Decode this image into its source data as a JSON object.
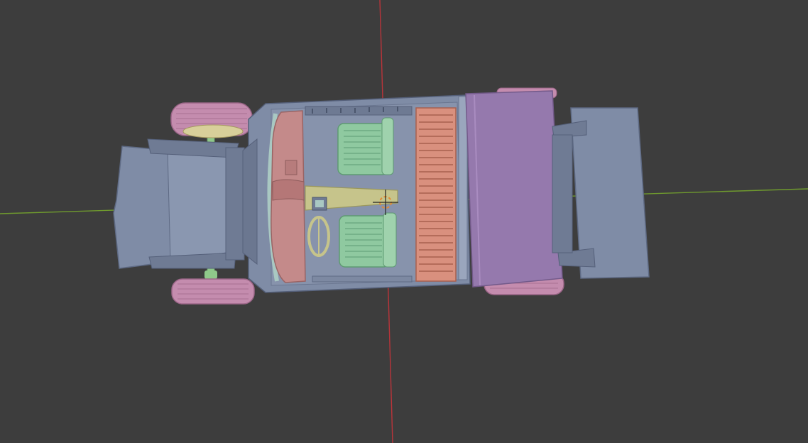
{
  "viewport": {
    "background": "#3d3d3d",
    "x_axis_color": "#6f9a2e",
    "y_axis_color": "#b9343a"
  },
  "scene": {
    "object": "car-model-top-view",
    "body_color": "#7f8ca6",
    "body_dark_color": "#5e6a84",
    "interior_floor_color": "#8793ac",
    "seat_color": "#8fc9a0",
    "dashboard_color": "#c48a8a",
    "cargo_slats_color": "#d9907e",
    "hood_panel_color": "#9579ad",
    "tire_color": "#c48cae",
    "axle_color": "#8fc88a",
    "console_color": "#c6c48b"
  },
  "cursor": {
    "icon": "3d-cursor-icon",
    "color": "#e38a33"
  }
}
